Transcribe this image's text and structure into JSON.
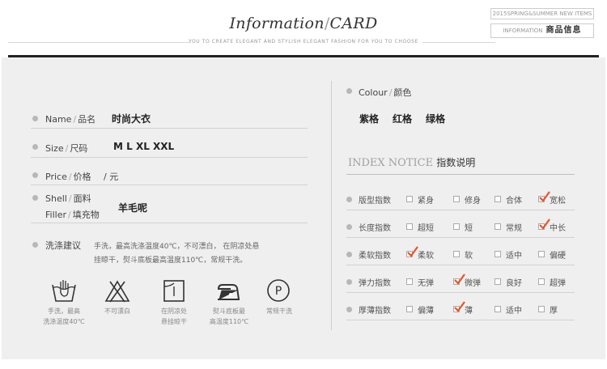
{
  "header": {
    "title_main": "Information",
    "title_slash": "/",
    "title_card": "CARD",
    "subtitle": "YOU TO CREATE ELEGANT AND STYLISH ELEGANT FASHION FOR YOU TO CHOOSE",
    "box_top": "2015SPRING&SUMMER NEW ITEMS",
    "box_bottom_en": "INFORMATION",
    "box_bottom_cn": "商品信息"
  },
  "left": {
    "name_label_en": "Name",
    "name_label_cn": "品名",
    "name_value": "时尚大衣",
    "size_label_en": "Size",
    "size_label_cn": "尺码",
    "size_value": "M  L  XL  XXL",
    "price_label_en": "Price",
    "price_label_cn": "价格",
    "price_value": "/ 元",
    "shell_label_en": "Shell",
    "shell_label_cn": "面料",
    "filler_label_en": "Filler",
    "filler_label_cn": "填充物",
    "material_value": "羊毛呢",
    "wash_label": "洗涤建议",
    "wash_text_1": "手洗，最高洗涤温度40℃，不可漂白， 在阴凉处悬",
    "wash_text_2": "挂晾干，熨斗底板最高温度110℃，常规干洗。"
  },
  "care": [
    {
      "icon": "hand-wash-icon",
      "line1": "手洗，最高",
      "line2": "洗涤温度40℃"
    },
    {
      "icon": "no-bleach-icon",
      "line1": "不可漂白",
      "line2": ""
    },
    {
      "icon": "line-dry-icon",
      "line1": "在阴凉处",
      "line2": "悬挂晾干"
    },
    {
      "icon": "iron-icon",
      "line1": "熨斗底板最",
      "line2": "高温度110℃"
    },
    {
      "icon": "dry-clean-icon",
      "line1": "常规干洗",
      "line2": ""
    }
  ],
  "care_p_glyph": "P",
  "right": {
    "colour_label_en": "Colour",
    "colour_label_cn": "颜色",
    "colours": [
      "紫格",
      "红格",
      "绿格"
    ],
    "index_title_en": "INDEX NOTICE",
    "index_title_cn": "指数说明"
  },
  "indices": [
    {
      "label": "版型指数",
      "options": [
        "紧身",
        "修身",
        "合体",
        "宽松"
      ],
      "checked": 3
    },
    {
      "label": "长度指数",
      "options": [
        "超短",
        "短",
        "常规",
        "中长"
      ],
      "checked": 3
    },
    {
      "label": "柔软指数",
      "options": [
        "柔软",
        "软",
        "适中",
        "偏硬"
      ],
      "checked": 0
    },
    {
      "label": "弹力指数",
      "options": [
        "无弹",
        "微弹",
        "良好",
        "超弹"
      ],
      "checked": 1
    },
    {
      "label": "厚薄指数",
      "options": [
        "偏薄",
        "薄",
        "适中",
        "厚"
      ],
      "checked": 1
    }
  ],
  "colors": {
    "check": "#e8542a",
    "panel": "#efefef"
  }
}
